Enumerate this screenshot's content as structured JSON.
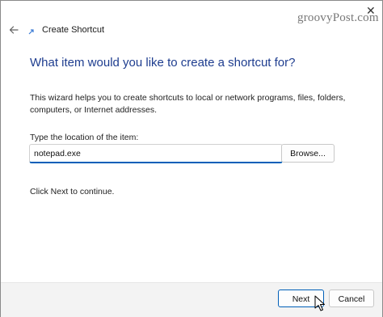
{
  "window": {
    "title": "Create Shortcut",
    "close_glyph": "✕",
    "watermark": "groovyPost.com"
  },
  "icons": {
    "back": "back-arrow-icon",
    "app": "shortcut-app-icon",
    "cursor": "mouse-pointer-icon"
  },
  "main": {
    "heading": "What item would you like to create a shortcut for?",
    "description": "This wizard helps you to create shortcuts to local or network programs, files, folders, computers, or Internet addresses.",
    "location_label": "Type the location of the item:",
    "location_value": "notepad.exe",
    "browse_label": "Browse...",
    "hint": "Click Next to continue."
  },
  "footer": {
    "next_label": "Next",
    "cancel_label": "Cancel"
  },
  "colors": {
    "heading": "#1e3d8f",
    "accent": "#005fb8",
    "footer_bg": "#f3f3f3"
  }
}
